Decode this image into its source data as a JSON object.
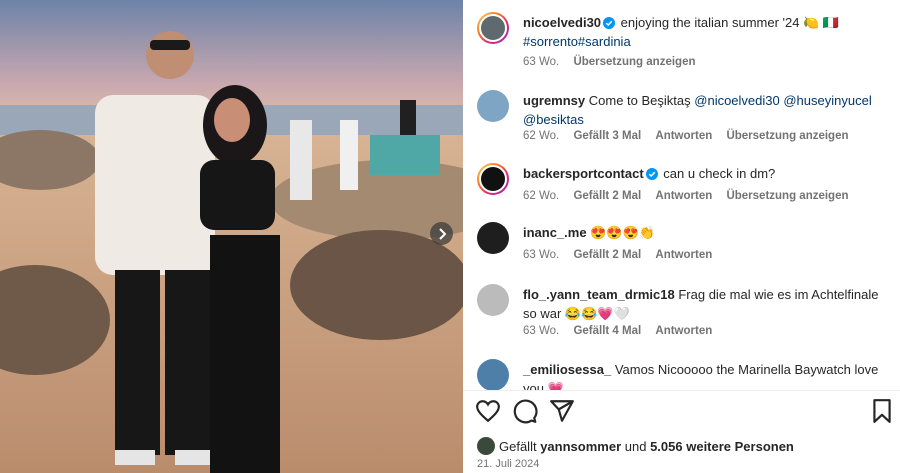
{
  "post": {
    "author": "nicoelvedi30",
    "caption": "enjoying the italian summer '24 🍋 🇮🇹",
    "hashtags": "#sorrento#sardinia",
    "age": "63 Wo.",
    "translate": "Übersetzung anzeigen"
  },
  "comments": [
    {
      "user": "ugremnsy",
      "text": "Come to Beşiktaş",
      "mentions": "@nicoelvedi30 @huseyinyucel @besiktas",
      "age": "62 Wo.",
      "likes": "Gefällt 3 Mal",
      "reply": "Antworten",
      "translate": "Übersetzung anzeigen"
    },
    {
      "user": "backersportcontact",
      "text": "can u check in dm?",
      "age": "62 Wo.",
      "likes": "Gefällt 2 Mal",
      "reply": "Antworten",
      "translate": "Übersetzung anzeigen"
    },
    {
      "user": "inanc_.me",
      "text": "😍😍😍👏",
      "age": "63 Wo.",
      "likes": "Gefällt 2 Mal",
      "reply": "Antworten"
    },
    {
      "user": "flo_.yann_team_drmic18",
      "text": "Frag die mal wie es im Achtelfinale so war 😂😂💗🤍",
      "age": "63 Wo.",
      "likes": "Gefällt 4 Mal",
      "reply": "Antworten"
    },
    {
      "user": "_emiliosessa_",
      "text": "Vamos Nicooooo the Marinella Baywatch love you 💗"
    }
  ],
  "footer": {
    "liked_prefix": "Gefällt",
    "liked_user": "yannsommer",
    "liked_mid": "und",
    "liked_count": "5.056 weitere Personen",
    "date": "21. Juli 2024"
  },
  "icons": {
    "like": "heart-icon",
    "comment": "comment-icon",
    "share": "share-icon",
    "save": "bookmark-icon",
    "next": "chevron-right-icon",
    "verified": "verified-badge-icon"
  },
  "colors": {
    "verified": "#0095f6",
    "mention": "#00376b",
    "meta": "#737373"
  }
}
